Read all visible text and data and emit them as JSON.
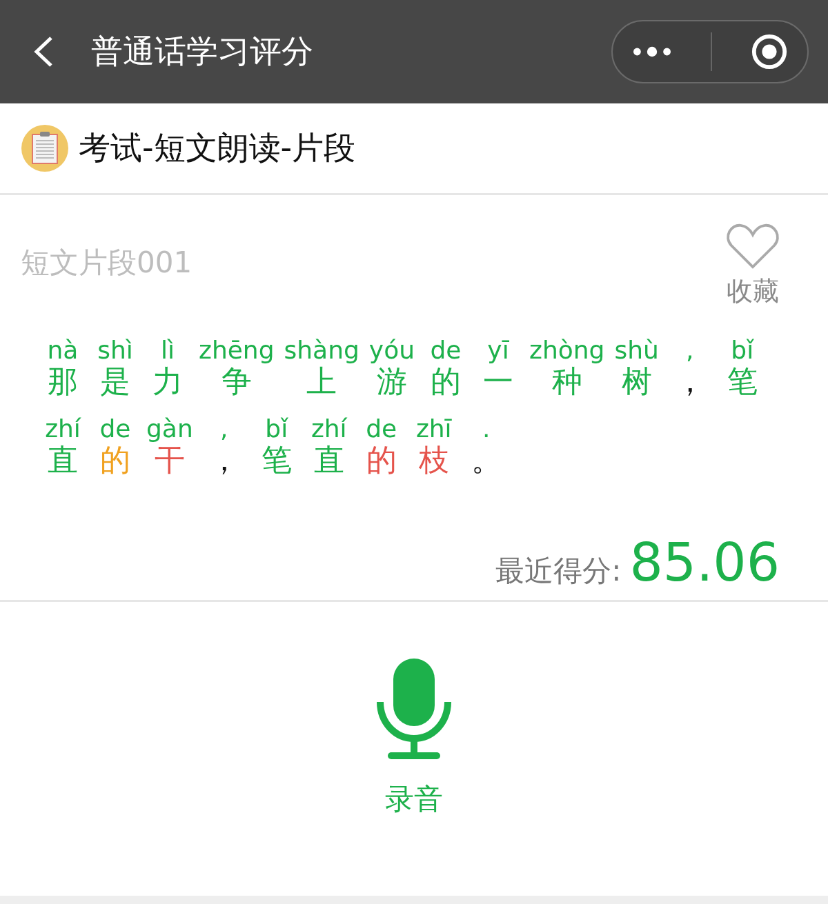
{
  "nav_bar": {
    "title": "普通话学习评分"
  },
  "header": {
    "title": "考试-短文朗读-片段"
  },
  "passage": {
    "title": "短文片段001",
    "favorite": {
      "label": "收藏",
      "favorited": false
    },
    "syllables": [
      {
        "pinyin": "nà",
        "char": "那",
        "color": "#1db14b"
      },
      {
        "pinyin": "shì",
        "char": "是",
        "color": "#1db14b"
      },
      {
        "pinyin": "lì",
        "char": "力",
        "color": "#1db14b"
      },
      {
        "pinyin": "zhēng",
        "char": "争",
        "color": "#1db14b"
      },
      {
        "pinyin": "shàng",
        "char": "上",
        "color": "#1db14b"
      },
      {
        "pinyin": "yóu",
        "char": "游",
        "color": "#1db14b"
      },
      {
        "pinyin": "de",
        "char": "的",
        "color": "#1db14b"
      },
      {
        "pinyin": "yī",
        "char": "一",
        "color": "#1db14b"
      },
      {
        "pinyin": "zhòng",
        "char": "种",
        "color": "#1db14b"
      },
      {
        "pinyin": "shù",
        "char": "树",
        "color": "#1db14b"
      },
      {
        "pinyin": ",",
        "char": "，",
        "color": "#111111"
      },
      {
        "pinyin": "bǐ",
        "char": "笔",
        "color": "#1db14b"
      },
      {
        "pinyin": "zhí",
        "char": "直",
        "color": "#1db14b"
      },
      {
        "pinyin": "de",
        "char": "的",
        "color": "#f0a11f"
      },
      {
        "pinyin": "gàn",
        "char": "干",
        "color": "#e5534b"
      },
      {
        "pinyin": ",",
        "char": "，",
        "color": "#111111"
      },
      {
        "pinyin": "bǐ",
        "char": "笔",
        "color": "#1db14b"
      },
      {
        "pinyin": "zhí",
        "char": "直",
        "color": "#1db14b"
      },
      {
        "pinyin": "de",
        "char": "的",
        "color": "#e5534b"
      },
      {
        "pinyin": "zhī",
        "char": "枝",
        "color": "#e5534b"
      },
      {
        "pinyin": ".",
        "char": "。",
        "color": "#111111"
      }
    ],
    "score_label": "最近得分:",
    "score": "85.06"
  },
  "record": {
    "label": "录音"
  }
}
